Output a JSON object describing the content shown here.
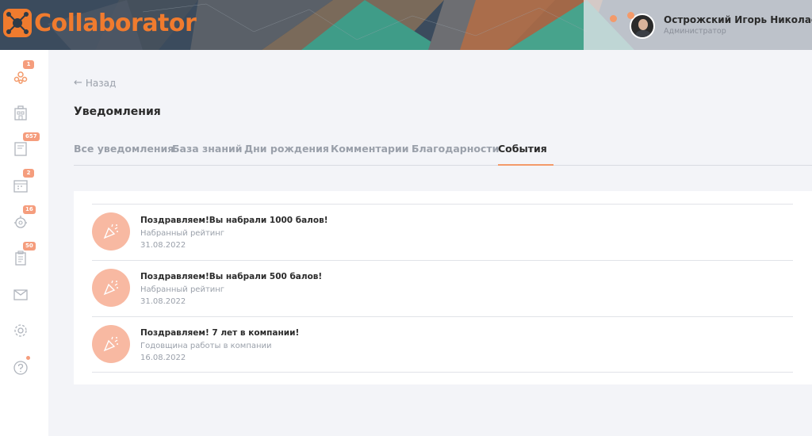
{
  "app": {
    "name": "Collaborator"
  },
  "user": {
    "name": "Острожский Игорь Николаевич",
    "role": "Администратор"
  },
  "sidebar": {
    "items": [
      {
        "icon": "team-icon",
        "badge": "1"
      },
      {
        "icon": "building-icon",
        "badge": ""
      },
      {
        "icon": "book-icon",
        "badge": "657"
      },
      {
        "icon": "calendar-icon",
        "badge": "2"
      },
      {
        "icon": "gear-face-icon",
        "badge": "16"
      },
      {
        "icon": "clipboard-icon",
        "badge": "50"
      },
      {
        "icon": "mail-icon",
        "badge": ""
      },
      {
        "icon": "settings-icon",
        "badge": ""
      },
      {
        "icon": "help-icon",
        "badge": ""
      }
    ]
  },
  "nav": {
    "back_label": "Назад"
  },
  "page": {
    "title": "Уведомления"
  },
  "tabs": [
    {
      "label": "Все уведомления",
      "active": false
    },
    {
      "label": "База знаний",
      "active": false
    },
    {
      "label": "Дни рождения",
      "active": false
    },
    {
      "label": "Комментарии",
      "active": false
    },
    {
      "label": "Благодарности",
      "active": false
    },
    {
      "label": "События",
      "active": true
    }
  ],
  "notifications": [
    {
      "title": "Поздравляем!Вы набрали 1000 балов!",
      "subtitle": "Набранный рейтинг",
      "date": "31.08.2022",
      "icon": "party-popper-icon"
    },
    {
      "title": "Поздравляем!Вы набрали 500 балов!",
      "subtitle": "Набранный рейтинг",
      "date": "31.08.2022",
      "icon": "party-popper-icon"
    },
    {
      "title": "Поздравляем! 7 лет в компании!",
      "subtitle": "Годовщина работы в компании",
      "date": "16.08.2022",
      "icon": "party-popper-icon"
    }
  ],
  "colors": {
    "accent": "#f07b2e",
    "badge": "#f59d7d",
    "icon_bg": "#f8b9a2",
    "header": "#3a4a5c"
  }
}
